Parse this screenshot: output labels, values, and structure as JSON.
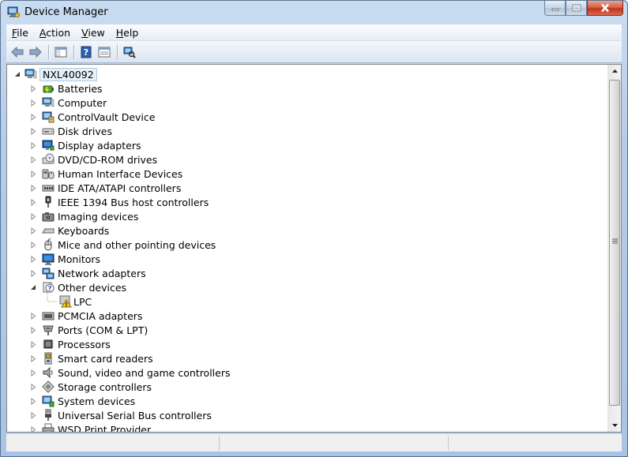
{
  "window": {
    "title": "Device Manager",
    "icon": "device-manager-icon"
  },
  "menu": [
    {
      "label": "File",
      "accel": "F",
      "rest": "ile"
    },
    {
      "label": "Action",
      "accel": "A",
      "rest": "ction"
    },
    {
      "label": "View",
      "accel": "V",
      "rest": "iew"
    },
    {
      "label": "Help",
      "accel": "H",
      "rest": "elp"
    }
  ],
  "toolbar": {
    "buttons": [
      "back-arrow-icon",
      "forward-arrow-icon",
      "show-hide-tree-icon",
      "help-icon",
      "properties-icon",
      "scan-hardware-icon"
    ]
  },
  "tree": {
    "root": {
      "label": "NXL40092",
      "icon": "computer-icon",
      "expanded": true
    },
    "nodes": [
      {
        "label": "Batteries",
        "icon": "battery-icon",
        "expanded": false
      },
      {
        "label": "Computer",
        "icon": "computer-icon",
        "expanded": false
      },
      {
        "label": "ControlVault Device",
        "icon": "controlvault-icon",
        "expanded": false
      },
      {
        "label": "Disk drives",
        "icon": "disk-drive-icon",
        "expanded": false
      },
      {
        "label": "Display adapters",
        "icon": "display-adapter-icon",
        "expanded": false
      },
      {
        "label": "DVD/CD-ROM drives",
        "icon": "dvd-drive-icon",
        "expanded": false
      },
      {
        "label": "Human Interface Devices",
        "icon": "hid-icon",
        "expanded": false
      },
      {
        "label": "IDE ATA/ATAPI controllers",
        "icon": "ide-controller-icon",
        "expanded": false
      },
      {
        "label": "IEEE 1394 Bus host controllers",
        "icon": "ieee1394-icon",
        "expanded": false
      },
      {
        "label": "Imaging devices",
        "icon": "camera-icon",
        "expanded": false
      },
      {
        "label": "Keyboards",
        "icon": "keyboard-icon",
        "expanded": false
      },
      {
        "label": "Mice and other pointing devices",
        "icon": "mouse-icon",
        "expanded": false
      },
      {
        "label": "Monitors",
        "icon": "monitor-icon",
        "expanded": false
      },
      {
        "label": "Network adapters",
        "icon": "network-adapter-icon",
        "expanded": false
      },
      {
        "label": "Other devices",
        "icon": "unknown-device-icon",
        "expanded": true,
        "children": [
          {
            "label": "LPC",
            "icon": "warning-device-icon"
          }
        ]
      },
      {
        "label": "PCMCIA adapters",
        "icon": "pcmcia-icon",
        "expanded": false
      },
      {
        "label": "Ports (COM & LPT)",
        "icon": "port-icon",
        "expanded": false
      },
      {
        "label": "Processors",
        "icon": "processor-icon",
        "expanded": false
      },
      {
        "label": "Smart card readers",
        "icon": "smart-card-icon",
        "expanded": false
      },
      {
        "label": "Sound, video and game controllers",
        "icon": "speaker-icon",
        "expanded": false
      },
      {
        "label": "Storage controllers",
        "icon": "storage-controller-icon",
        "expanded": false
      },
      {
        "label": "System devices",
        "icon": "system-device-icon",
        "expanded": false
      },
      {
        "label": "Universal Serial Bus controllers",
        "icon": "usb-icon",
        "expanded": false
      },
      {
        "label": "WSD Print Provider",
        "icon": "printer-icon",
        "expanded": false
      }
    ]
  },
  "colors": {
    "selection_bg": "#e5f0fb",
    "selection_border": "#7da2ce",
    "title_gradient_top": "#c9dcf1",
    "close_button": "#c2341a"
  }
}
